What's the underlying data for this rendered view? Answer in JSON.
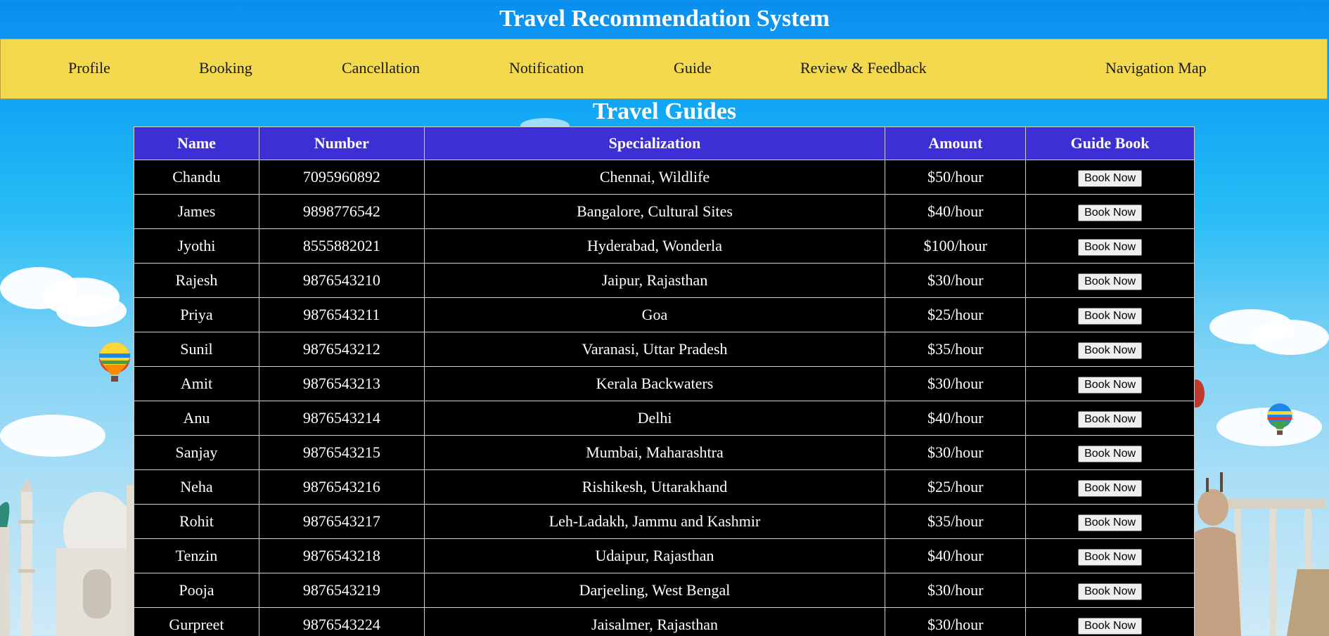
{
  "header": {
    "title": "Travel Recommendation System"
  },
  "nav": {
    "items": [
      {
        "label": "Profile"
      },
      {
        "label": "Booking"
      },
      {
        "label": "Cancellation"
      },
      {
        "label": "Notification"
      },
      {
        "label": "Guide"
      },
      {
        "label": "Review & Feedback"
      },
      {
        "label": "Navigation Map"
      }
    ]
  },
  "colors": {
    "nav_background": "#f4d94e",
    "table_header": "#3c2fd6",
    "table_body": "#000000"
  },
  "guides": {
    "title": "Travel Guides",
    "columns": [
      "Name",
      "Number",
      "Specialization",
      "Amount",
      "Guide Book"
    ],
    "book_label": "Book Now",
    "rows": [
      {
        "name": "Chandu",
        "number": "7095960892",
        "specialization": "Chennai, Wildlife",
        "amount": "$50/hour"
      },
      {
        "name": "James",
        "number": "9898776542",
        "specialization": "Bangalore, Cultural Sites",
        "amount": "$40/hour"
      },
      {
        "name": "Jyothi",
        "number": "8555882021",
        "specialization": "Hyderabad, Wonderla",
        "amount": "$100/hour"
      },
      {
        "name": "Rajesh",
        "number": "9876543210",
        "specialization": "Jaipur, Rajasthan",
        "amount": "$30/hour"
      },
      {
        "name": "Priya",
        "number": "9876543211",
        "specialization": "Goa",
        "amount": "$25/hour"
      },
      {
        "name": "Sunil",
        "number": "9876543212",
        "specialization": "Varanasi, Uttar Pradesh",
        "amount": "$35/hour"
      },
      {
        "name": "Amit",
        "number": "9876543213",
        "specialization": "Kerala Backwaters",
        "amount": "$30/hour"
      },
      {
        "name": "Anu",
        "number": "9876543214",
        "specialization": "Delhi",
        "amount": "$40/hour"
      },
      {
        "name": "Sanjay",
        "number": "9876543215",
        "specialization": "Mumbai, Maharashtra",
        "amount": "$30/hour"
      },
      {
        "name": "Neha",
        "number": "9876543216",
        "specialization": "Rishikesh, Uttarakhand",
        "amount": "$25/hour"
      },
      {
        "name": "Rohit",
        "number": "9876543217",
        "specialization": "Leh-Ladakh, Jammu and Kashmir",
        "amount": "$35/hour"
      },
      {
        "name": "Tenzin",
        "number": "9876543218",
        "specialization": "Udaipur, Rajasthan",
        "amount": "$40/hour"
      },
      {
        "name": "Pooja",
        "number": "9876543219",
        "specialization": "Darjeeling, West Bengal",
        "amount": "$30/hour"
      },
      {
        "name": "Gurpreet",
        "number": "9876543224",
        "specialization": "Jaisalmer, Rajasthan",
        "amount": "$30/hour"
      }
    ]
  }
}
